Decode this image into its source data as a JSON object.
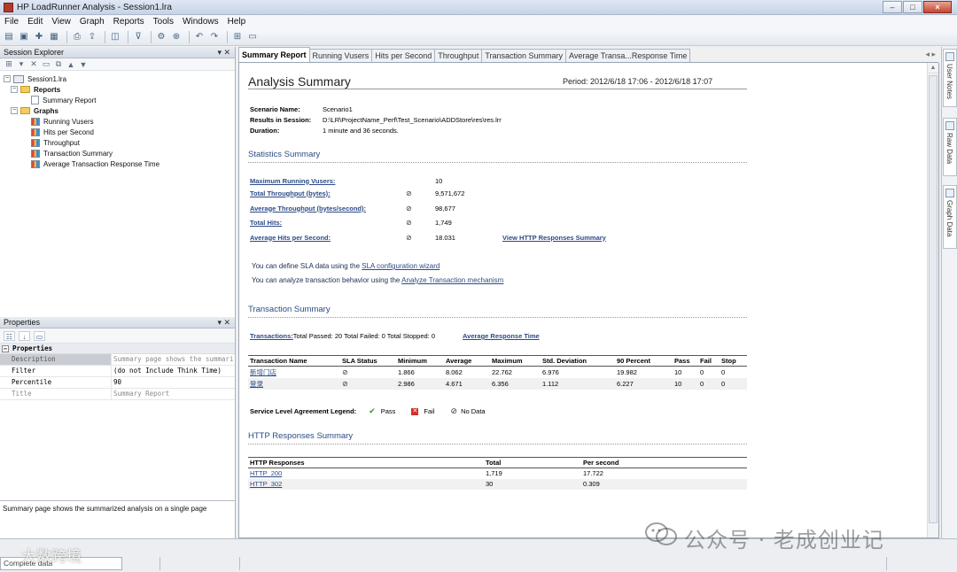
{
  "window": {
    "title": "HP LoadRunner Analysis - Session1.lra",
    "controls": {
      "minimize": "–",
      "maximize": "□",
      "close": "×"
    }
  },
  "menu": [
    "File",
    "Edit",
    "View",
    "Graph",
    "Reports",
    "Tools",
    "Windows",
    "Help"
  ],
  "toolbar_icons": [
    "open-icon",
    "save-icon",
    "new-report-icon",
    "save-report-icon",
    "print-icon",
    "export-icon",
    "graph-add-icon",
    "filter-icon",
    "settings-icon",
    "zoom-icon",
    "undo-icon",
    "redo-icon",
    "layout-icon",
    "display-icon"
  ],
  "session_explorer": {
    "title": "Session Explorer",
    "header_controls": "▾ ✕",
    "tree": {
      "root": "Session1.lra",
      "reports_folder": "Reports",
      "reports": [
        "Summary Report"
      ],
      "graphs_folder": "Graphs",
      "graphs": [
        "Running Vusers",
        "Hits per Second",
        "Throughput",
        "Transaction Summary",
        "Average Transaction Response Time"
      ]
    }
  },
  "properties": {
    "title": "Properties",
    "header_controls": "▾ ✕",
    "category": "Properties",
    "rows": [
      {
        "name": "Description",
        "value": "Summary page shows the summari"
      },
      {
        "name": "Filter",
        "value": "(do not Include Think Time)"
      },
      {
        "name": "Percentile",
        "value": "90"
      },
      {
        "name": "Title",
        "value": "Summary Report"
      }
    ],
    "description": "Summary page shows the summarized analysis on a single page"
  },
  "tabs": [
    "Summary Report",
    "Running Vusers",
    "Hits per Second",
    "Throughput",
    "Transaction Summary",
    "Average Transa...Response Time"
  ],
  "report": {
    "title": "Analysis Summary",
    "period": "Period: 2012/6/18 17:06 - 2012/6/18 17:07",
    "meta": [
      {
        "key": "Scenario Name:",
        "value": "Scenario1"
      },
      {
        "key": "Results in Session:",
        "value": "D:\\LR\\ProjectName_Perf\\Test_Scenario\\ADDStore\\res\\res.lrr"
      },
      {
        "key": "Duration:",
        "value": "1 minute and 36 seconds."
      }
    ],
    "statistics_title": "Statistics Summary",
    "statistics": [
      {
        "label": "Maximum Running Vusers:",
        "sla": "",
        "value": "10",
        "link": ""
      },
      {
        "label": "Total Throughput (bytes):",
        "sla": "⊘",
        "value": "9,571,672",
        "link": ""
      },
      {
        "label": "Average Throughput (bytes/second):",
        "sla": "⊘",
        "value": "98,677",
        "link": ""
      },
      {
        "label": "Total Hits:",
        "sla": "⊘",
        "value": "1,749",
        "link": ""
      },
      {
        "label": "Average Hits per Second:",
        "sla": "⊘",
        "value": "18.031",
        "link": "View HTTP Responses Summary"
      }
    ],
    "sla_line": {
      "prefix": "You can define SLA data using the ",
      "link": "SLA configuration wizard"
    },
    "analyze_line": {
      "prefix": "You can analyze transaction behavior using the ",
      "link": "Analyze Transaction mechanism"
    },
    "transaction_title": "Transaction Summary",
    "transaction_line": {
      "link": "Transactions:",
      "text": " Total Passed: 20 Total Failed: 0 Total Stopped: 0",
      "link2": "Average Response Time"
    },
    "transaction_table": {
      "headers": [
        "Transaction Name",
        "SLA Status",
        "Minimum",
        "Average",
        "Maximum",
        "Std. Deviation",
        "90 Percent",
        "Pass",
        "Fail",
        "Stop"
      ],
      "rows": [
        [
          "新增门店",
          "⊘",
          "1.866",
          "8.062",
          "22.762",
          "6.976",
          "19.982",
          "10",
          "0",
          "0"
        ],
        [
          "登录",
          "⊘",
          "2.986",
          "4.671",
          "6.356",
          "1.112",
          "6.227",
          "10",
          "0",
          "0"
        ]
      ]
    },
    "legend": {
      "title": "Service Level Agreement Legend:",
      "pass": "Pass",
      "fail": "Fail",
      "nodata": "No Data"
    },
    "http_title": "HTTP Responses Summary",
    "http_table": {
      "headers": [
        "HTTP Responses",
        "Total",
        "Per second"
      ],
      "rows": [
        [
          "HTTP_200",
          "1,719",
          "17.722"
        ],
        [
          "HTTP_302",
          "30",
          "0.309"
        ]
      ]
    }
  },
  "right_tabs": [
    "User Notes",
    "Raw Data",
    "Graph Data"
  ],
  "status": {
    "progress_text": "Complete data"
  },
  "watermark": "公众号 · 老成创业记",
  "watermark2": "大数跨境"
}
